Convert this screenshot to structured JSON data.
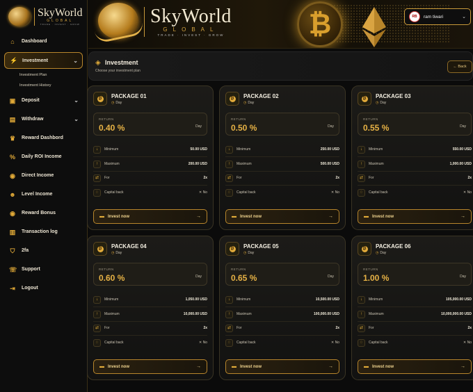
{
  "brand": {
    "name": "SkyWorld",
    "sub": "GLOBAL",
    "tagline": "TRADE · INVEST · GROW"
  },
  "user": {
    "name": "ram tiwari",
    "avatar_text": "RB"
  },
  "sidebar": {
    "items": [
      {
        "label": "Dashboard",
        "icon": "home-icon"
      },
      {
        "label": "Investment",
        "icon": "bolt-icon"
      },
      {
        "label": "Deposit",
        "icon": "gift-icon"
      },
      {
        "label": "Withdraw",
        "icon": "wallet-icon"
      },
      {
        "label": "Reward Dashbord",
        "icon": "trophy-icon"
      },
      {
        "label": "Daily ROI Income",
        "icon": "percent-icon"
      },
      {
        "label": "Direct Income",
        "icon": "hand-coin-icon"
      },
      {
        "label": "Level Income",
        "icon": "users-icon"
      },
      {
        "label": "Reward Bonus",
        "icon": "hand-coin-icon"
      },
      {
        "label": "Transaction log",
        "icon": "document-icon"
      },
      {
        "label": "2fa",
        "icon": "shield-icon"
      },
      {
        "label": "Support",
        "icon": "support-icon"
      },
      {
        "label": "Logout",
        "icon": "logout-icon"
      }
    ],
    "investment_sub": [
      "Investment Plan",
      "Investment History"
    ]
  },
  "page": {
    "title": "Investment",
    "description": "Choose your investment plan",
    "back_label": "Back"
  },
  "labels": {
    "return": "RETURN",
    "per": "Day",
    "minimum": "Minimum",
    "maximum": "Maximum",
    "for": "For",
    "capital_back": "Capital back",
    "invest_now": "Invest now"
  },
  "packages": [
    {
      "name": "PACKAGE 01",
      "duration": "Day",
      "return": "0.40 %",
      "minimum": "50.00 USD",
      "maximum": "200.00 USD",
      "for": "2x",
      "capital_back": "✕ No"
    },
    {
      "name": "PACKAGE 02",
      "duration": "Day",
      "return": "0.50 %",
      "minimum": "250.00 USD",
      "maximum": "500.00 USD",
      "for": "2x",
      "capital_back": "✕ No"
    },
    {
      "name": "PACKAGE 03",
      "duration": "Day",
      "return": "0.55 %",
      "minimum": "550.00 USD",
      "maximum": "1,000.00 USD",
      "for": "2x",
      "capital_back": "✕ No"
    },
    {
      "name": "PACKAGE 04",
      "duration": "Day",
      "return": "0.60 %",
      "minimum": "1,050.00 USD",
      "maximum": "10,000.00 USD",
      "for": "2x",
      "capital_back": "✕ No"
    },
    {
      "name": "PACKAGE 05",
      "duration": "Day",
      "return": "0.65 %",
      "minimum": "10,500.00 USD",
      "maximum": "100,000.00 USD",
      "for": "2x",
      "capital_back": "✕ No"
    },
    {
      "name": "PACKAGE 06",
      "duration": "Day",
      "return": "1.00 %",
      "minimum": "105,000.00 USD",
      "maximum": "10,000,000.00 USD",
      "for": "2x",
      "capital_back": "✕ No"
    }
  ],
  "colors": {
    "accent": "#e3ad3a",
    "background": "#0b0b0b",
    "card": "#1c1b18"
  }
}
